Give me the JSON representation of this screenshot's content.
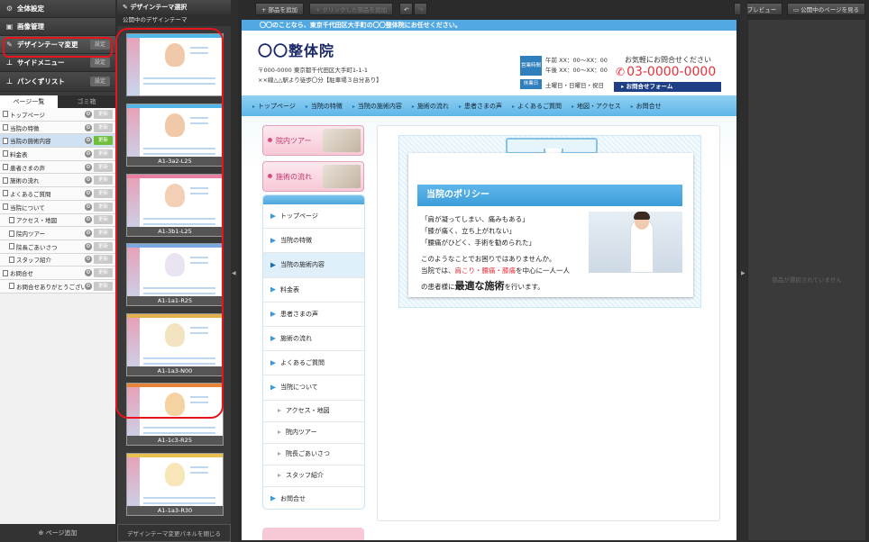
{
  "left_menu": {
    "items": [
      {
        "label": "全体設定",
        "icon": "gear-icon"
      },
      {
        "label": "画像管理",
        "icon": "image-icon"
      },
      {
        "label": "デザインテーマ変更",
        "icon": "pencil-icon",
        "button": "設定"
      },
      {
        "label": "サイドメニュー",
        "icon": "sitemap-icon",
        "button": "設定"
      },
      {
        "label": "パンくずリスト",
        "icon": "sitemap-icon",
        "button": "設定"
      }
    ]
  },
  "page_tabs": {
    "pages": "ページ一覧",
    "trash": "ゴミ箱"
  },
  "pages": [
    {
      "label": "トップページ",
      "update": "更新",
      "child": false,
      "selected": false
    },
    {
      "label": "当院の特徴",
      "update": "更新",
      "child": false,
      "selected": false
    },
    {
      "label": "当院の施術内容",
      "update": "更新",
      "child": false,
      "selected": true
    },
    {
      "label": "料金表",
      "update": "更新",
      "child": false,
      "selected": false
    },
    {
      "label": "患者さまの声",
      "update": "更新",
      "child": false,
      "selected": false
    },
    {
      "label": "施術の流れ",
      "update": "更新",
      "child": false,
      "selected": false
    },
    {
      "label": "よくあるご質問",
      "update": "更新",
      "child": false,
      "selected": false
    },
    {
      "label": "当院について",
      "update": "更新",
      "child": false,
      "selected": false
    },
    {
      "label": "アクセス・地図",
      "update": "更新",
      "child": true,
      "selected": false
    },
    {
      "label": "院内ツアー",
      "update": "更新",
      "child": true,
      "selected": false
    },
    {
      "label": "院長ごあいさつ",
      "update": "更新",
      "child": true,
      "selected": false
    },
    {
      "label": "スタッフ紹介",
      "update": "更新",
      "child": true,
      "selected": false
    },
    {
      "label": "お問合せ",
      "update": "更新",
      "child": false,
      "selected": false
    },
    {
      "label": "お問合せありがとうございます",
      "update": "更新",
      "child": true,
      "selected": false
    }
  ],
  "add_page": "ページ追加",
  "theme_panel": {
    "title": "デザインテーマ選択",
    "subtitle": "公開中のデザインテーマ",
    "close": "デザインテーマ変更パネルを閉じる",
    "themes": [
      "",
      "A1-3a2-L25",
      "A1-3b1-L25",
      "A1-1a1-R25",
      "A1-1a3-N00",
      "A1-1c3-R25",
      "A1-1a3-R30"
    ]
  },
  "toolbar": {
    "add_part": "部品を追加",
    "add_part_click": "クリックした部品を追加",
    "preview": "プレビュー",
    "view_public": "公開中のページを見る"
  },
  "right_panel": {
    "message": "部品が選択されていません"
  },
  "site": {
    "top_bar": "〇〇のことなら、東京千代田区大手町の〇〇整体院にお任せください。",
    "name": "〇〇整体院",
    "address1": "〒000-0000 東京都千代田区大手町1-1-1",
    "address2": "××線△△駅より徒歩〇分【駐車場３台分あり】",
    "hours_badge": "営業時間",
    "hours_am": "午前 XX：00〜XX：00",
    "hours_pm": "午後 XX：00〜XX：00",
    "holiday_badge": "休業日",
    "holiday": "土曜日・日曜日・祝日",
    "contact_label": "お気軽にお問合せください",
    "phone": "03-0000-0000",
    "form_button": "お問合せフォーム",
    "nav": [
      "トップページ",
      "当院の特徴",
      "当院の施術内容",
      "施術の流れ",
      "患者さまの声",
      "よくあるご質問",
      "地図・アクセス",
      "お問合せ"
    ],
    "banners": [
      "院内ツアー",
      "施術の流れ"
    ],
    "sidenav": [
      {
        "label": "トップページ",
        "child": false,
        "active": false
      },
      {
        "label": "当院の特徴",
        "child": false,
        "active": false
      },
      {
        "label": "当院の施術内容",
        "child": false,
        "active": true
      },
      {
        "label": "料金表",
        "child": false,
        "active": false
      },
      {
        "label": "患者さまの声",
        "child": false,
        "active": false
      },
      {
        "label": "施術の流れ",
        "child": false,
        "active": false
      },
      {
        "label": "よくあるご質問",
        "child": false,
        "active": false
      },
      {
        "label": "当院について",
        "child": false,
        "active": false
      },
      {
        "label": "アクセス・地図",
        "child": true,
        "active": false
      },
      {
        "label": "院内ツアー",
        "child": true,
        "active": false
      },
      {
        "label": "院長ごあいさつ",
        "child": true,
        "active": false
      },
      {
        "label": "スタッフ紹介",
        "child": true,
        "active": false
      },
      {
        "label": "お問合せ",
        "child": false,
        "active": false
      }
    ],
    "policy_title": "当院のポリシー",
    "quotes": [
      "「肩が凝ってしまい、痛みもある」",
      "「膝が痛く、立ち上がれない」",
      "「腰痛がひどく、手術を勧められた」"
    ],
    "body1": "このようなことでお困りではありませんか。",
    "body2_pre": "当院では、",
    "body2_red": "肩こり・腰痛・膝痛",
    "body2_post": "を中心に一人一人",
    "body3_pre": "の患者様に",
    "body3_big": "最適な施術",
    "body3_post": "を行います。"
  }
}
